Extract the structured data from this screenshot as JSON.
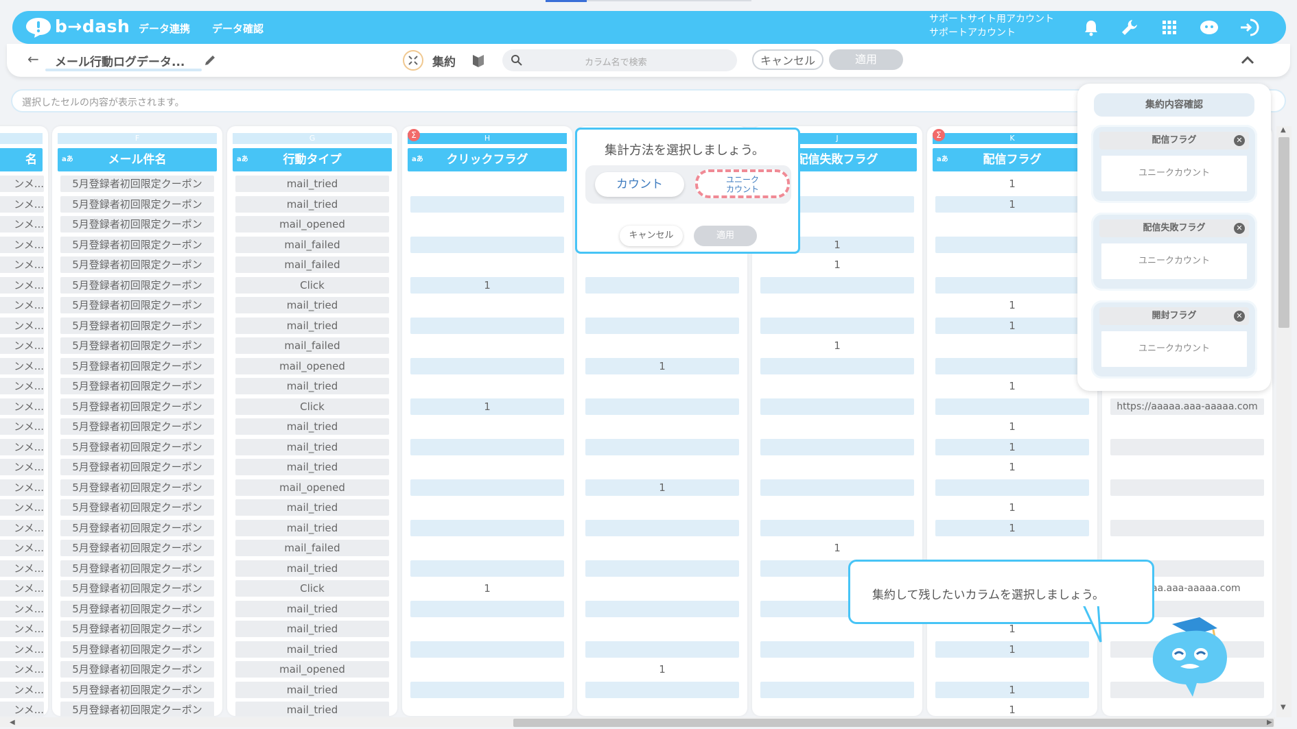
{
  "header": {
    "logo_text": "b→dash",
    "nav": [
      "データ連携",
      "データ確認"
    ],
    "account_line1": "サポートサイト用アカウント",
    "account_line2": "サポートアカウント"
  },
  "subheader": {
    "back_label": "←",
    "dataset_title": "メール行動ログデータ...",
    "aggregate_label": "集約",
    "search_placeholder": "カラム名で検索",
    "cancel_label": "キャンセル",
    "apply_label": "適用",
    "collapse_label": "^"
  },
  "cellbar": {
    "placeholder": "選択したセルの内容が表示されます。"
  },
  "grid": {
    "columns": [
      {
        "letter": "",
        "name": "名",
        "type": "",
        "sigma": false
      },
      {
        "letter": "F",
        "name": "メール件名",
        "type": "aあ",
        "sigma": false
      },
      {
        "letter": "G",
        "name": "行動タイプ",
        "type": "aあ",
        "sigma": false
      },
      {
        "letter": "H",
        "name": "クリックフラグ",
        "type": "aあ",
        "sigma": true
      },
      {
        "letter": "I",
        "name": "",
        "type": "",
        "sigma": false
      },
      {
        "letter": "J",
        "name": "配信失敗フラグ",
        "type": "",
        "sigma": false
      },
      {
        "letter": "K",
        "name": "配信フラグ",
        "type": "aあ",
        "sigma": true
      },
      {
        "letter": "",
        "name": "",
        "type": "",
        "sigma": false
      }
    ],
    "colE_value": "ンメ...",
    "colF_value": "5月登録者初回限定クーポン",
    "colG_values": [
      "mail_tried",
      "mail_tried",
      "mail_opened",
      "mail_failed",
      "mail_failed",
      "Click",
      "mail_tried",
      "mail_tried",
      "mail_failed",
      "mail_opened",
      "mail_tried",
      "Click",
      "mail_tried",
      "mail_tried",
      "mail_tried",
      "mail_opened",
      "mail_tried",
      "mail_tried",
      "mail_failed",
      "mail_tried",
      "Click",
      "mail_tried",
      "mail_tried",
      "mail_tried",
      "mail_opened",
      "mail_tried",
      "mail_tried"
    ],
    "colH_values": [
      "",
      "",
      "",
      "",
      "",
      "1",
      "",
      "",
      "",
      "",
      "",
      "1",
      "",
      "",
      "",
      "",
      "",
      "",
      "",
      "",
      "1",
      "",
      "",
      "",
      "",
      "",
      ""
    ],
    "colI_values": [
      "",
      "",
      "",
      "",
      "",
      "",
      "",
      "",
      "",
      "1",
      "",
      "",
      "",
      "",
      "",
      "1",
      "",
      "",
      "",
      "",
      "",
      "",
      "",
      "",
      "1",
      "",
      ""
    ],
    "colJ_values": [
      "",
      "",
      "",
      "1",
      "1",
      "",
      "",
      "",
      "1",
      "",
      "",
      "",
      "",
      "",
      "",
      "",
      "",
      "",
      "1",
      "",
      "",
      "",
      "",
      "",
      "",
      "",
      ""
    ],
    "colK_values": [
      "1",
      "1",
      "",
      "",
      "",
      "",
      "1",
      "1",
      "",
      "",
      "1",
      "",
      "1",
      "1",
      "1",
      "",
      "1",
      "1",
      "",
      "",
      "",
      "",
      "1",
      "1",
      "",
      "1",
      "1"
    ],
    "colL_values": [
      "",
      "",
      "",
      "",
      "",
      "",
      "",
      "",
      "",
      "",
      "",
      "https://aaaaa.aaa-aaaaa.com",
      "",
      "",
      "",
      "",
      "",
      "",
      "",
      "",
      "aaaaa.aaa-aaaaa.com",
      "",
      "",
      "",
      "",
      "",
      ""
    ]
  },
  "agg_popup": {
    "title": "集計方法を選択しましょう。",
    "option_count": "カウント",
    "option_unique_line1": "ユニーク",
    "option_unique_line2": "カウント",
    "cancel_label": "キャンセル",
    "apply_label": "適用"
  },
  "right_panel": {
    "title": "集約内容確認",
    "cards": [
      {
        "column": "配信フラグ",
        "method": "ユニークカウント"
      },
      {
        "column": "配信失敗フラグ",
        "method": "ユニークカウント"
      },
      {
        "column": "開封フラグ",
        "method": "ユニークカウント"
      }
    ]
  },
  "tutorial": {
    "message": "集約して残したいカラムを選択しましょう。"
  },
  "colors": {
    "brand": "#47c4f6",
    "sigma": "#f26a6a",
    "dashed_highlight": "#f08a95"
  }
}
